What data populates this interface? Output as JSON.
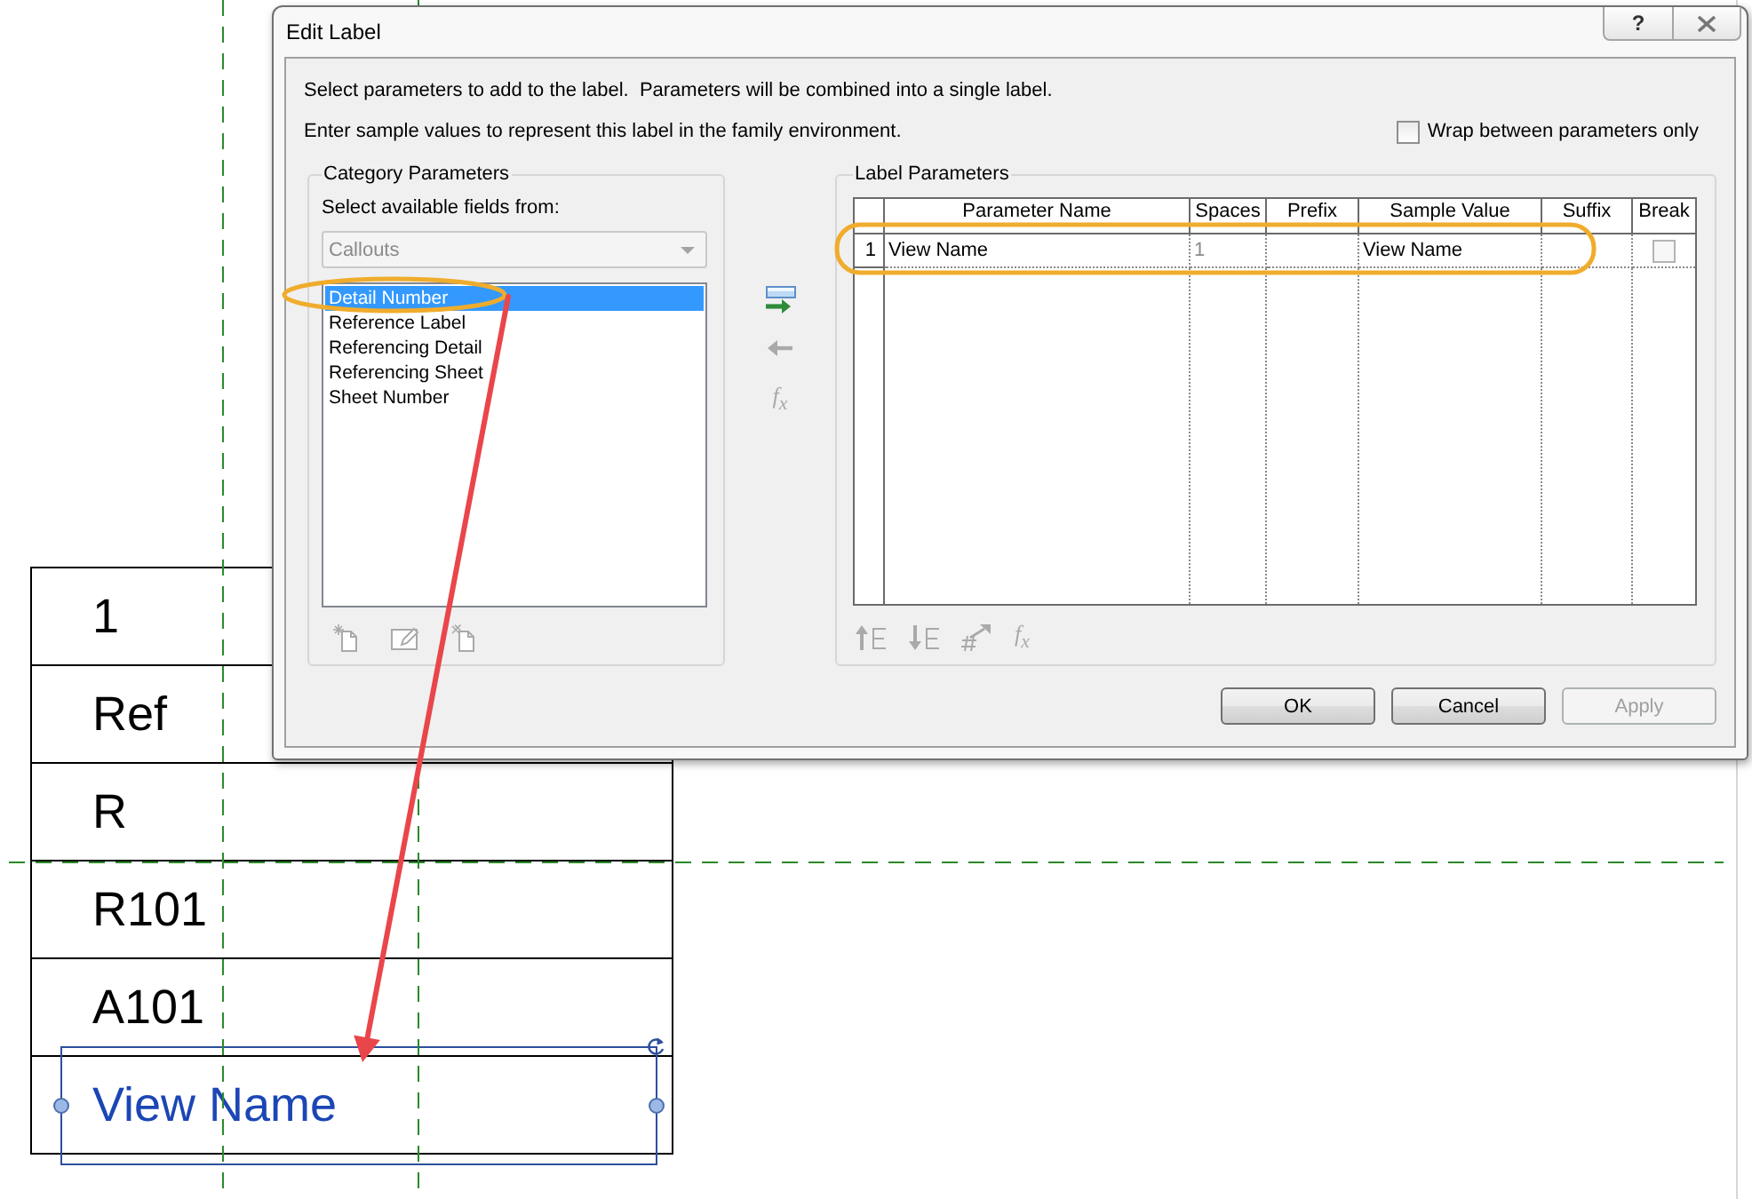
{
  "tag_table": {
    "rows": [
      {
        "text": "1",
        "selected": false
      },
      {
        "text": "Ref",
        "selected": false
      },
      {
        "text": "R",
        "selected": false
      },
      {
        "text": "R101",
        "selected": false
      },
      {
        "text": "A101",
        "selected": false
      },
      {
        "text": "View Name",
        "selected": true
      }
    ]
  },
  "dialog": {
    "title": "Edit Label",
    "help_button": "?",
    "instructions": [
      "Select parameters to add to the label.  Parameters will be combined into a single label.",
      "Enter sample values to represent this label in the family environment."
    ],
    "wrap_checkbox": {
      "label": "Wrap between parameters only",
      "checked": false
    },
    "category_parameters": {
      "title": "Category Parameters",
      "prompt": "Select available fields from:",
      "dropdown": {
        "value": "Callouts",
        "disabled": true
      },
      "fields": [
        {
          "label": "Detail Number",
          "selected": true
        },
        {
          "label": "Reference Label",
          "selected": false
        },
        {
          "label": "Referencing Detail",
          "selected": false
        },
        {
          "label": "Referencing Sheet",
          "selected": false
        },
        {
          "label": "Sheet Number",
          "selected": false
        }
      ],
      "tools": [
        {
          "kind": "new",
          "disabled": true
        },
        {
          "kind": "edit",
          "disabled": true
        },
        {
          "kind": "delete",
          "disabled": true
        }
      ]
    },
    "transfer_tools": [
      {
        "kind": "add",
        "disabled": false
      },
      {
        "kind": "remove",
        "disabled": true
      },
      {
        "kind": "formula",
        "label": "f$_{x}$",
        "disabled": true
      }
    ],
    "label_parameters": {
      "title": "Label Parameters",
      "columns": [
        "Parameter Name",
        "Spaces",
        "Prefix",
        "Sample Value",
        "Suffix",
        "Break"
      ],
      "rows": [
        {
          "number": "1",
          "parameter_name": "View Name",
          "spaces": "1",
          "sample_value": "View Name",
          "break": false
        }
      ],
      "tools": [
        {
          "kind": "move-up",
          "disabled": true
        },
        {
          "kind": "move-down",
          "disabled": true
        },
        {
          "kind": "hash",
          "disabled": true
        },
        {
          "kind": "formula",
          "label": "f$_{x}$",
          "disabled": true
        }
      ]
    },
    "buttons": [
      {
        "label": "OK",
        "disabled": false
      },
      {
        "label": "Cancel",
        "disabled": false
      },
      {
        "label": "Apply",
        "disabled": true
      }
    ]
  }
}
